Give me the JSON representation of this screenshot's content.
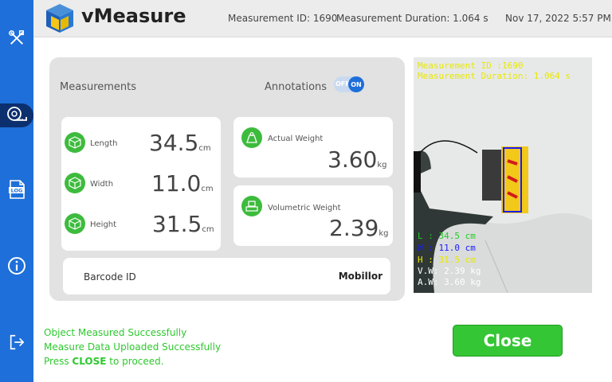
{
  "app": {
    "title": "vMeasure"
  },
  "header": {
    "measurement_id": "Measurement ID: 1690",
    "duration": "Measurement Duration: 1.064 s",
    "datetime": "Nov 17, 2022 5:57 PM"
  },
  "sidebar": {
    "items": [
      {
        "icon": "tools-icon"
      },
      {
        "icon": "tape-measure-icon",
        "active": true
      },
      {
        "icon": "log-icon",
        "text": "LOG"
      },
      {
        "icon": "info-icon"
      },
      {
        "icon": "logout-icon"
      }
    ]
  },
  "panel": {
    "measurements_label": "Measurements",
    "annotations_label": "Annotations",
    "toggle": {
      "off_label": "OFF",
      "on_label": "ON",
      "state": "on"
    }
  },
  "dimensions": [
    {
      "label": "Length",
      "value": "34.5",
      "unit": "cm"
    },
    {
      "label": "Width",
      "value": "11.0",
      "unit": "cm"
    },
    {
      "label": "Height",
      "value": "31.5",
      "unit": "cm"
    }
  ],
  "weights": {
    "actual": {
      "label": "Actual Weight",
      "value": "3.60",
      "unit": "kg"
    },
    "volumetric": {
      "label": "Volumetric Weight",
      "value": "2.39",
      "unit": "kg"
    }
  },
  "barcode": {
    "label": "Barcode ID",
    "value": "Mobillor"
  },
  "camera_overlay": {
    "id": "Measurement ID :1690",
    "duration": "Measurement Duration: 1.064 s",
    "length": "L  : 34.5 cm",
    "width": "W  : 11.0 cm",
    "height": "H  : 31.5 cm",
    "vw": "V.W: 2.39 kg",
    "aw": "A.W: 3.60 kg"
  },
  "status": {
    "line1": "Object Measured Successfully",
    "line2": "Measure Data Uploaded Successfully",
    "line3_prefix": "Press ",
    "line3_bold": "CLOSE",
    "line3_suffix": " to proceed."
  },
  "close_button": {
    "label": "Close"
  },
  "colors": {
    "sidebar": "#1e6fd9",
    "accent_green": "#3dbb3d",
    "status_green": "#2ec92e",
    "overlay_yellow": "#e8e800",
    "overlay_blue": "#1a1aff",
    "overlay_green": "#22cc22"
  }
}
